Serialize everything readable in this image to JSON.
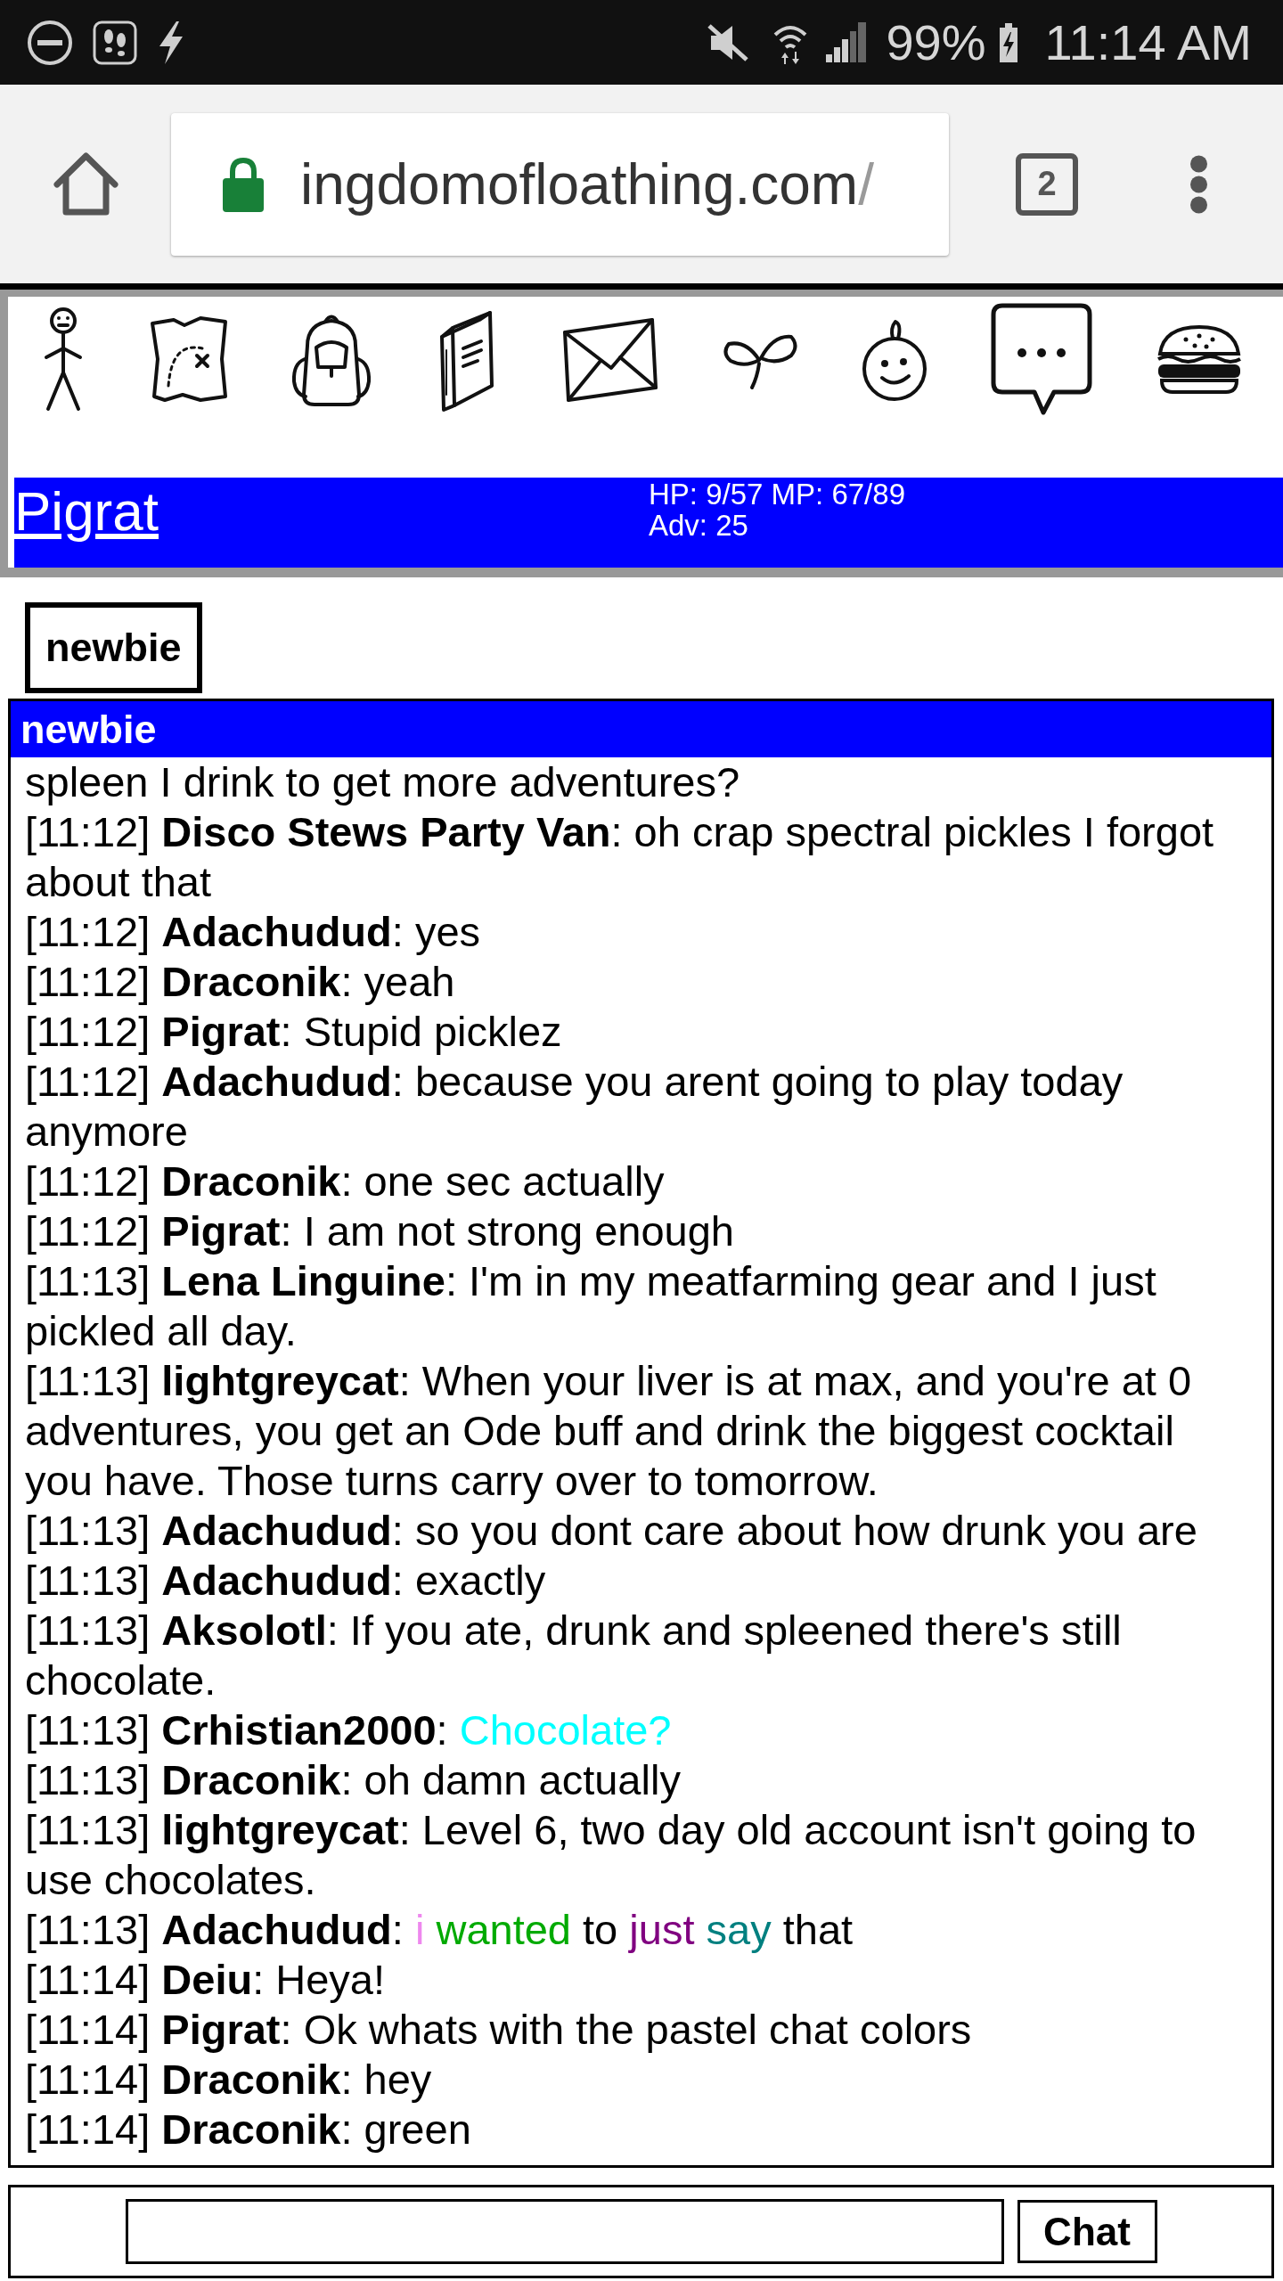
{
  "status_bar": {
    "battery": "99%",
    "time": "11:14 AM"
  },
  "browser": {
    "url_host": "ingdomofloathing.com",
    "url_path": "/",
    "tab_count": "2"
  },
  "character_pane": {
    "name": "Pigrat",
    "stats": [
      "HP: 9/57 MP: 67/89",
      "Adv: 25"
    ]
  },
  "chat": {
    "tabs": [
      {
        "label": "newbie",
        "selected": true
      }
    ],
    "channel_title": "newbie",
    "messages": [
      {
        "parts": [
          {
            "text": "spleen I drink to get more adventures?"
          }
        ]
      },
      {
        "parts": [
          {
            "text": "[11:12] **Disco Stews Party Van**: oh crap spectral pickles I forgot about that"
          }
        ]
      },
      {
        "parts": [
          {
            "text": "[11:12] **Adachudud**: yes"
          }
        ]
      },
      {
        "parts": [
          {
            "text": "[11:12] **Draconik**: yeah"
          }
        ]
      },
      {
        "parts": [
          {
            "text": "[11:12] **Pigrat**: Stupid picklez"
          }
        ]
      },
      {
        "parts": [
          {
            "text": "[11:12] **Adachudud**: because you arent going to play today anymore"
          }
        ]
      },
      {
        "parts": [
          {
            "text": "[11:12] **Draconik**: one sec actually"
          }
        ]
      },
      {
        "parts": [
          {
            "text": "[11:12] **Pigrat**: I am not strong enough"
          }
        ]
      },
      {
        "parts": [
          {
            "text": "[11:13] **Lena Linguine**: I'm in my meatfarming gear and I just pickled all day."
          }
        ]
      },
      {
        "parts": [
          {
            "text": "[11:13] **lightgreycat**: When your liver is at max, and you're at 0 adventures, you get an Ode buff and drink the biggest cocktail you have. Those turns carry over to tomorrow."
          }
        ]
      },
      {
        "parts": [
          {
            "text": "[11:13] **Adachudud**: so you dont care about how drunk you are"
          }
        ]
      },
      {
        "parts": [
          {
            "text": "[11:13] **Adachudud**: exactly"
          }
        ]
      },
      {
        "parts": [
          {
            "text": "[11:13] **Aksolotl**: If you ate, drunk and spleened there's still chocolate."
          }
        ]
      },
      {
        "parts": [
          {
            "text": "[11:13] **Crhistian2000**:"
          },
          {
            "text": "Chocolate?",
            "color": "#00ffff"
          }
        ]
      },
      {
        "parts": [
          {
            "text": "[11:13] **Draconik**: oh damn actually"
          }
        ]
      },
      {
        "parts": [
          {
            "text": "[11:13] **lightgreycat**: Level 6, two day old account isn't going to use chocolates."
          }
        ]
      },
      {
        "parts": [
          {
            "text": "[11:13] **Adachudud**:"
          },
          {
            "text": "i",
            "color": "#ee88ee"
          },
          {
            "text": "wanted",
            "color": "#00aa00"
          },
          {
            "text": "to"
          },
          {
            "text": "just",
            "color": "#800080"
          },
          {
            "text": "say",
            "color": "#008080"
          },
          {
            "text": "that"
          }
        ]
      },
      {
        "parts": [
          {
            "text": "[11:14] **Deiu**: Heya!"
          }
        ]
      },
      {
        "parts": [
          {
            "text": "[11:14] **Pigrat**: Ok whats with the pastel chat colors"
          }
        ]
      },
      {
        "parts": [
          {
            "text": "[11:14] **Draconik**: hey"
          }
        ]
      },
      {
        "parts": [
          {
            "text": "[11:14] **Draconik**: green"
          }
        ]
      }
    ],
    "send_button": "Chat"
  }
}
